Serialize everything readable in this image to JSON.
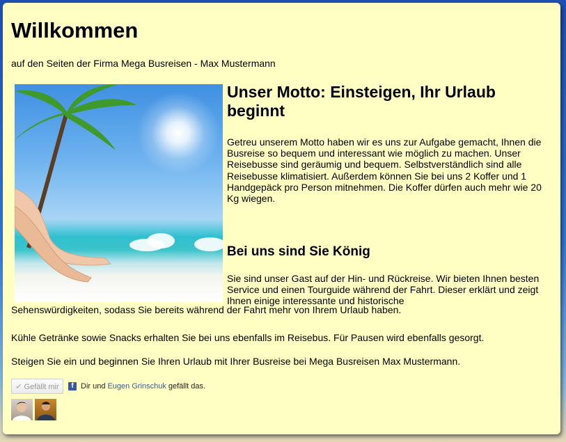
{
  "header": {
    "title": "Willkommen",
    "subtitle": "auf den Seiten der Firma Mega Busreisen - Max Mustermann"
  },
  "sections": {
    "motto": {
      "heading": "Unser Motto: Einsteigen, Ihr Urlaub beginnt",
      "text": "Getreu unserem Motto haben wir es uns zur Aufgabe gemacht, Ihnen die Busreise so bequem und interessant wie möglich zu machen. Unser Reisebusse sind geräumig und bequem. Selbstverständlich sind alle Reisebusse klimatisiert. Außerdem können Sie bei uns 2 Koffer und 1 Handgepäck pro Person mitnehmen. Die Koffer dürfen auch mehr wie 20 Kg wiegen."
    },
    "koenig": {
      "heading": "Bei uns sind Sie König",
      "text_a": "Sie sind unser Gast auf der Hin- und Rückreise. Wir bieten Ihnen besten Service und einen Tourguide während der Fahrt. Dieser erklärt und zeigt Ihnen einige interessante und historische",
      "text_b": "Sehenswürdigkeiten, sodass Sie bereits während der Fahrt mehr von Ihrem Urlaub haben.",
      "text_2": "Kühle Getränke sowie Snacks erhalten Sie bei uns ebenfalls im Reisebus. Für Pausen wird ebenfalls gesorgt.",
      "text_3": "Steigen Sie ein und beginnen Sie Ihren Urlaub mit Ihrer Busreise bei Mega Busreisen Max Mustermann."
    }
  },
  "facebook": {
    "like_label": "Gefällt mir",
    "icon_letter": "f",
    "text_prefix": "Dir und",
    "friend_name": "Eugen Grinschuk",
    "text_suffix": "gefällt das.",
    "brand_color": "#3b5998"
  },
  "colors": {
    "panel_background": "#ffffc4"
  }
}
